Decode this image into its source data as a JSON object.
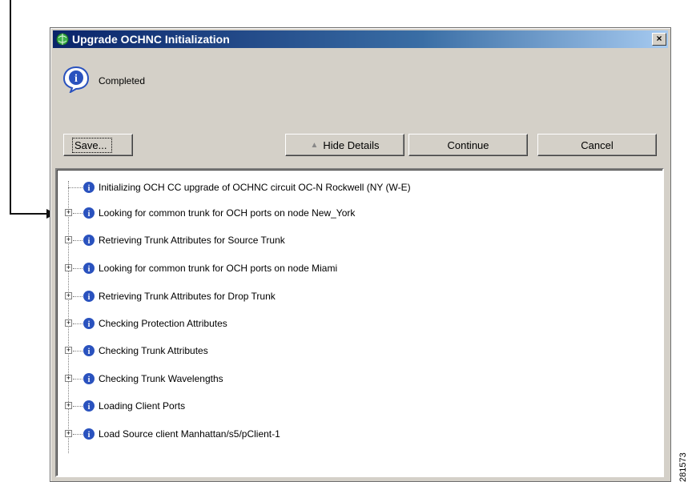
{
  "dialog": {
    "title": "Upgrade OCHNC Initialization",
    "status": "Completed",
    "close_glyph": "×"
  },
  "buttons": {
    "save": "Save...",
    "hide_details": "Hide Details",
    "continue": "Continue",
    "cancel": "Cancel"
  },
  "tree": {
    "items": [
      {
        "label": "Initializing OCH CC upgrade of OCHNC circuit OC-N Rockwell (NY (W-E)",
        "expandable": false
      },
      {
        "label": "Looking for common trunk for OCH ports on node New_York",
        "expandable": true
      },
      {
        "label": "Retrieving Trunk Attributes for Source Trunk",
        "expandable": true
      },
      {
        "label": "Looking for common trunk for OCH ports on node Miami",
        "expandable": true
      },
      {
        "label": "Retrieving Trunk Attributes for Drop Trunk",
        "expandable": true
      },
      {
        "label": "Checking Protection Attributes",
        "expandable": true
      },
      {
        "label": "Checking Trunk Attributes",
        "expandable": true
      },
      {
        "label": "Checking Trunk Wavelengths",
        "expandable": true
      },
      {
        "label": "Loading Client Ports",
        "expandable": true
      },
      {
        "label": "Load Source client Manhattan/s5/pClient-1",
        "expandable": true
      }
    ]
  },
  "figure_number": "281573",
  "icons": {
    "app": "globe-app-icon",
    "info": "info-icon",
    "close": "close-icon",
    "expand": "plus-expander-icon"
  },
  "colors": {
    "titlebar_start": "#0a246a",
    "titlebar_end": "#a6caf0",
    "dialog_bg": "#d4d0c8",
    "info_blue": "#2a52be"
  }
}
